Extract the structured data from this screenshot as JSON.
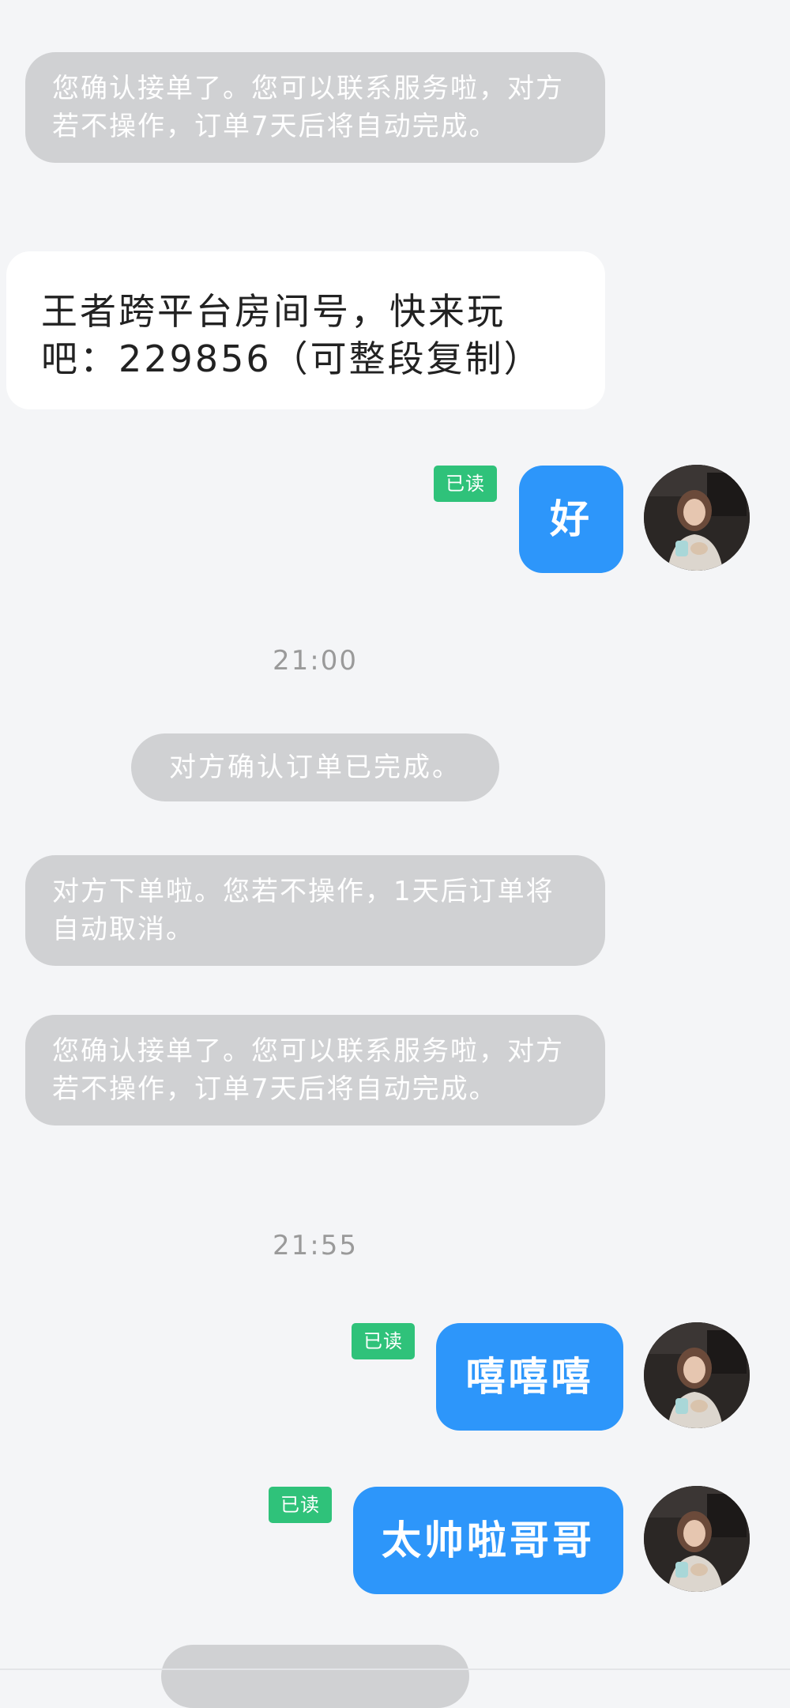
{
  "messages": {
    "sys_accept_1": "您确认接单了。您可以联系服务啦，对方若不操作，订单7天后将自动完成。",
    "room_card": "王者跨平台房间号，快来玩吧：229856（可整段复制）",
    "reply_1": "好",
    "time_1": "21:00",
    "sys_completed": "对方确认订单已完成。",
    "sys_ordered": "对方下单啦。您若不操作，1天后订单将自动取消。",
    "sys_accept_2": "您确认接单了。您可以联系服务啦，对方若不操作，订单7天后将自动完成。",
    "time_2": "21:55",
    "reply_2": "嘻嘻嘻",
    "reply_3": "太帅啦哥哥"
  },
  "badges": {
    "read": "已读"
  },
  "colors": {
    "background": "#f4f5f7",
    "system_bubble": "#d0d1d3",
    "outgoing_bubble": "#2d96fa",
    "read_badge": "#2fc27a",
    "timestamp": "#9a9a9a"
  },
  "icons": {
    "avatar": "user-avatar-photo"
  }
}
